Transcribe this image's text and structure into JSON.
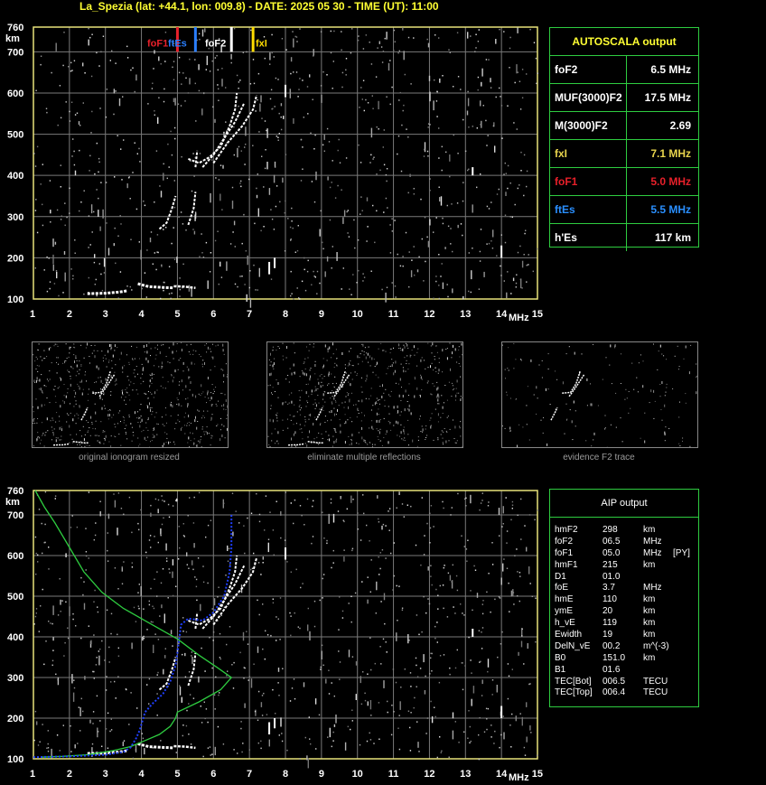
{
  "header": {
    "title": "La_Spezia (lat: +44.1, lon: 009.8) - DATE: 2025 05 30 - TIME (UT): 11:00"
  },
  "axes": {
    "y_unit": "km",
    "x_unit": "MHz",
    "y_ticks": [
      "760",
      "700",
      "600",
      "500",
      "400",
      "300",
      "200",
      "100"
    ],
    "x_ticks": [
      "1",
      "2",
      "3",
      "4",
      "5",
      "6",
      "7",
      "8",
      "9",
      "10",
      "11",
      "12",
      "13",
      "14",
      "15"
    ]
  },
  "markers": [
    {
      "label": "foF1",
      "freq": 5.0,
      "color": "#e8202a"
    },
    {
      "label": "ftEs",
      "freq": 5.5,
      "color": "#2a7fff"
    },
    {
      "label": "foF2",
      "freq": 6.5,
      "color": "#ffffff"
    },
    {
      "label": "fxI",
      "freq": 7.1,
      "color": "#ffdd00"
    }
  ],
  "autoscala": {
    "title": "AUTOSCALA output",
    "rows": [
      {
        "label": "foF2",
        "value": "6.5 MHz",
        "color": "#ffffff"
      },
      {
        "label": "MUF(3000)F2",
        "value": "17.5 MHz",
        "color": "#ffffff"
      },
      {
        "label": "M(3000)F2",
        "value": "2.69",
        "color": "#ffffff"
      },
      {
        "label": "fxI",
        "value": "7.1 MHz",
        "color": "#e8d44d"
      },
      {
        "label": "foF1",
        "value": "5.0 MHz",
        "color": "#e8202a"
      },
      {
        "label": "ftEs",
        "value": "5.5 MHz",
        "color": "#2a8fff"
      },
      {
        "label": "h'Es",
        "value": "117     km",
        "color": "#ffffff"
      }
    ]
  },
  "thumbnails": {
    "captions": [
      "original ionogram resized",
      "eliminate multiple reflections",
      "evidence F2 trace"
    ]
  },
  "aip": {
    "title": "AIP output",
    "rows": [
      {
        "name": "hmF2",
        "value": "298",
        "unit": "km",
        "extra": ""
      },
      {
        "name": "foF2",
        "value": "06.5",
        "unit": "MHz",
        "extra": ""
      },
      {
        "name": "foF1",
        "value": "05.0",
        "unit": "MHz",
        "extra": "[PY]"
      },
      {
        "name": "hmF1",
        "value": "215",
        "unit": "km",
        "extra": ""
      },
      {
        "name": "D1",
        "value": "01.0",
        "unit": "",
        "extra": ""
      },
      {
        "name": "foE",
        "value": "3.7",
        "unit": "MHz",
        "extra": ""
      },
      {
        "name": "hmE",
        "value": "110",
        "unit": "km",
        "extra": ""
      },
      {
        "name": "ymE",
        "value": "20",
        "unit": "km",
        "extra": ""
      },
      {
        "name": "h_vE",
        "value": "119",
        "unit": "km",
        "extra": ""
      },
      {
        "name": "Ewidth",
        "value": "19",
        "unit": "km",
        "extra": ""
      },
      {
        "name": "DelN_vE",
        "value": "00.2",
        "unit": "m^(-3)",
        "extra": ""
      },
      {
        "name": "B0",
        "value": "151.0",
        "unit": "km",
        "extra": ""
      },
      {
        "name": "B1",
        "value": "01.6",
        "unit": "",
        "extra": ""
      },
      {
        "name": "TEC[Bot]",
        "value": "006.5",
        "unit": "TECU",
        "extra": ""
      },
      {
        "name": "TEC[Top]",
        "value": "006.4",
        "unit": "TECU",
        "extra": ""
      }
    ]
  },
  "colors": {
    "grid": "#7a7a7a",
    "frame": "#e8e27a",
    "panel_border": "#2ecc40",
    "profile": "#2ecc40",
    "trace_blue": "#2040ff"
  }
}
